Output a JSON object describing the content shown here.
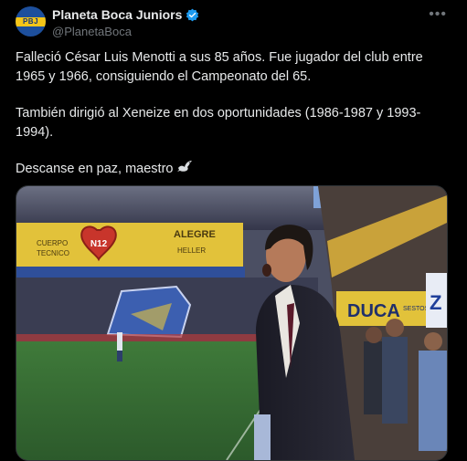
{
  "account": {
    "name": "Planeta Boca Juniors",
    "handle": "@PlanetaBoca",
    "avatar_text": "PBJ",
    "verified_icon": "verified-badge-icon",
    "more_icon": "more-options-icon",
    "verified_color": "#1d9bf0"
  },
  "post": {
    "paragraph_1": "Falleció César Luis Menotti a sus 85 años. Fue jugador del club entre 1965 y 1966, consiguiendo el Campeonato del 65.",
    "paragraph_2": "También dirigió al Xeneize en dos oportunidades (1986-1987 y 1993-1994).",
    "paragraph_3": "Descanse en paz, maestro",
    "emoji_icon": "dove-icon"
  },
  "photo": {
    "banner_left_1": "CUERPO",
    "banner_left_2": "TECNICO",
    "banner_heart": "N12",
    "banner_right_1": "ALEGRE",
    "banner_right_2": "HELLER",
    "stand_sign_1": "DUCA",
    "stand_sign_2": "SESTOS",
    "stand_sign_3": "Z"
  }
}
